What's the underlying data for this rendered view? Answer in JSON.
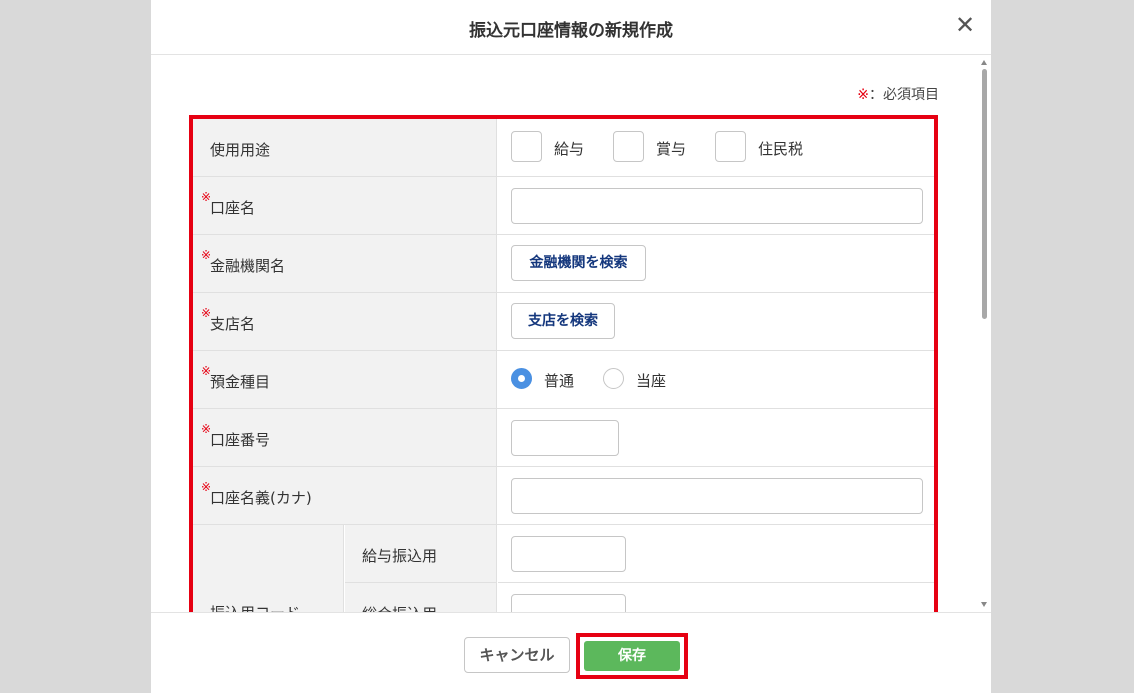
{
  "modal": {
    "title": "振込元口座情報の新規作成",
    "close_icon": "close-icon"
  },
  "required_note": {
    "mark": "※",
    "text": "：必須項目"
  },
  "form": {
    "usage": {
      "label": "使用用途",
      "options": [
        "給与",
        "賞与",
        "住民税"
      ]
    },
    "account_name": {
      "label": "口座名",
      "required_mark": "※",
      "value": ""
    },
    "bank_name": {
      "label": "金融機関名",
      "required_mark": "※",
      "button": "金融機関を検索"
    },
    "branch_name": {
      "label": "支店名",
      "required_mark": "※",
      "button": "支店を検索"
    },
    "deposit_type": {
      "label": "預金種目",
      "required_mark": "※",
      "options": [
        "普通",
        "当座"
      ],
      "selected": "普通"
    },
    "account_number": {
      "label": "口座番号",
      "required_mark": "※",
      "value": ""
    },
    "account_holder": {
      "label": "口座名義(カナ)",
      "required_mark": "※",
      "value": ""
    },
    "transfer_code": {
      "label": "振込用コード",
      "salary_label": "給与振込用",
      "general_label": "総合振込用",
      "salary_value": "",
      "general_value": ""
    }
  },
  "footer": {
    "cancel": "キャンセル",
    "save": "保存"
  },
  "colors": {
    "highlight_border": "#e60012",
    "save_button": "#5cb85c",
    "radio_selected": "#4a90e2",
    "link_button_text": "#14377d"
  }
}
